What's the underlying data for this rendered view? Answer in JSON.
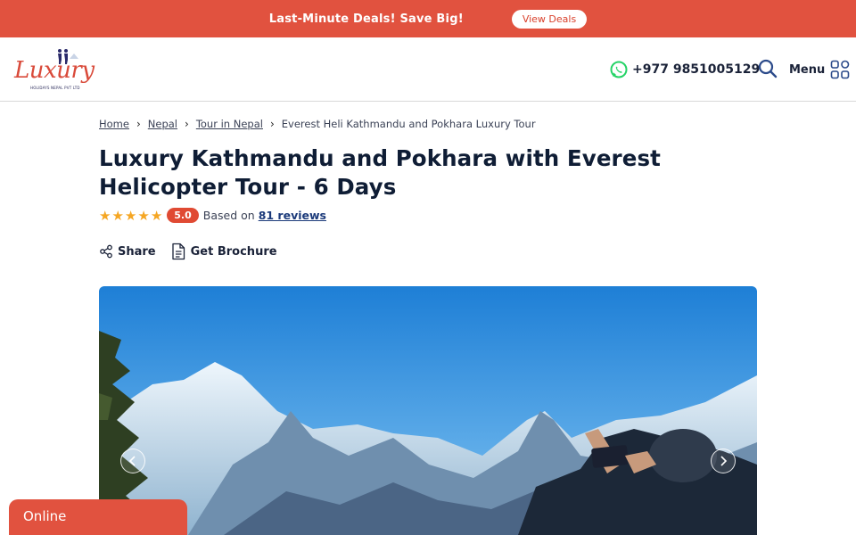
{
  "promo": {
    "text": "Last-Minute Deals! Save Big!",
    "button_label": "View Deals"
  },
  "header": {
    "logo_text": "Luxury",
    "logo_subtext": "HOLIDAYS NEPAL PVT LTD",
    "phone": "+977 9851005129",
    "menu_label": "Menu"
  },
  "breadcrumb": {
    "items": [
      "Home",
      "Nepal",
      "Tour in Nepal"
    ],
    "current": "Everest Heli Kathmandu and Pokhara Luxury Tour"
  },
  "tour": {
    "title": "Luxury Kathmandu and Pokhara with Everest Helicopter Tour - 6 Days",
    "rating_stars": 5,
    "score": "5.0",
    "based_on": "Based on",
    "reviews_link": "81 reviews"
  },
  "actions": {
    "share": "Share",
    "brochure": "Get Brochure"
  },
  "chat": {
    "label": "Online"
  },
  "icons": {
    "whatsapp": "whatsapp-icon",
    "search": "search-icon",
    "menu": "grid-menu-icon",
    "share": "share-icon",
    "brochure": "document-icon",
    "prev": "chevron-left-icon",
    "next": "chevron-right-icon"
  },
  "colors": {
    "accent": "#e1523f",
    "star": "#f5a623",
    "title": "#0f1d35",
    "whatsapp": "#25d366"
  }
}
